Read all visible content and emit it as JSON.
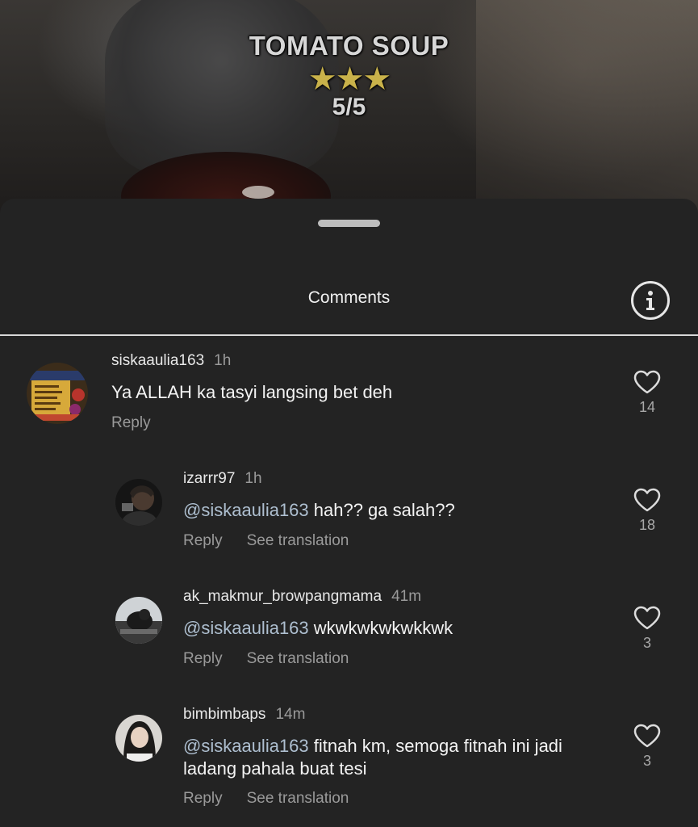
{
  "video_overlay": {
    "title": "TOMATO SOUP",
    "stars": "★★★",
    "rating": "5/5"
  },
  "sheet": {
    "title": "Comments",
    "info_icon": "info-circle-icon"
  },
  "comments": [
    {
      "username": "siskaaulia163",
      "time": "1h",
      "mention": "",
      "text": "Ya ALLAH ka tasyi langsing bet deh",
      "reply_label": "Reply",
      "translate_label": "",
      "likes": "14"
    },
    {
      "username": "izarrr97",
      "time": "1h",
      "mention": "@siskaaulia163",
      "text": " hah?? ga salah??",
      "reply_label": "Reply",
      "translate_label": "See translation",
      "likes": "18"
    },
    {
      "username": "ak_makmur_browpangmama",
      "time": "41m",
      "mention": "@siskaaulia163",
      "text": " wkwkwkwkwkkwk",
      "reply_label": "Reply",
      "translate_label": "See translation",
      "likes": "3"
    },
    {
      "username": "bimbimbaps",
      "time": "14m",
      "mention": "@siskaaulia163",
      "text": " fitnah km, semoga fitnah ini jadi ladang pahala buat tesi",
      "reply_label": "Reply",
      "translate_label": "See translation",
      "likes": "3"
    }
  ],
  "colors": {
    "sheet_bg": "#232323",
    "mention": "#aebfd0",
    "muted_text": "#9a9a9a"
  }
}
